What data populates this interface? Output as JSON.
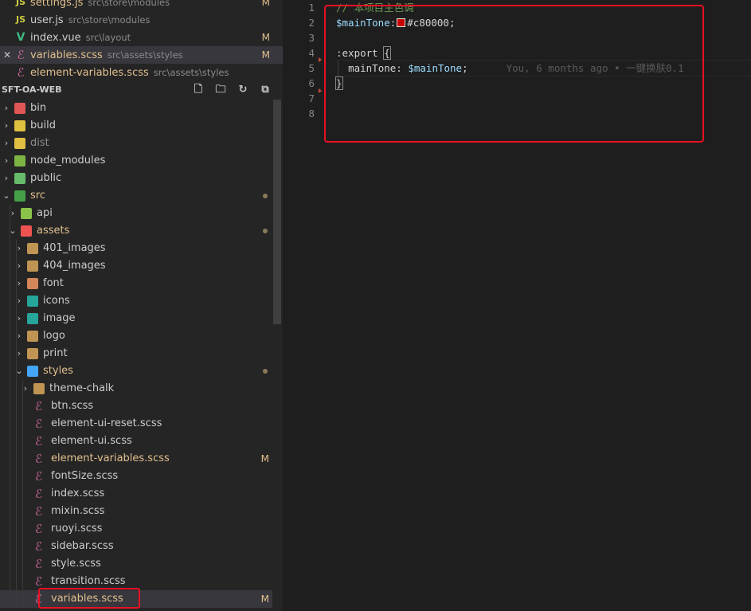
{
  "open_editors": [
    {
      "icon": "js",
      "name": "settings.js",
      "path": "src\\store\\modules",
      "badge": "M",
      "modified": true
    },
    {
      "icon": "js",
      "name": "user.js",
      "path": "src\\store\\modules",
      "badge": "",
      "modified": false
    },
    {
      "icon": "vue",
      "name": "index.vue",
      "path": "src\\layout",
      "badge": "M",
      "modified": false
    },
    {
      "icon": "scss",
      "name": "variables.scss",
      "path": "src\\assets\\styles",
      "badge": "M",
      "modified": true,
      "active": true,
      "close": "✕"
    },
    {
      "icon": "scss",
      "name": "element-variables.scss",
      "path": "src\\assets\\styles",
      "badge": "",
      "modified": true
    }
  ],
  "explorer": {
    "title": "SFT-OA-WEB",
    "tree": [
      {
        "label": "bin",
        "depth": 0,
        "type": "folder",
        "open": false,
        "icon": "bin-folder-icon",
        "color": "#e05555"
      },
      {
        "label": "build",
        "depth": 0,
        "type": "folder",
        "open": false,
        "icon": "build-folder-icon",
        "color": "#e0c040"
      },
      {
        "label": "dist",
        "depth": 0,
        "type": "folder",
        "open": false,
        "icon": "dist-folder-icon",
        "color": "#e0c040",
        "dim": true
      },
      {
        "label": "node_modules",
        "depth": 0,
        "type": "folder",
        "open": false,
        "icon": "node-folder-icon",
        "color": "#7cb342"
      },
      {
        "label": "public",
        "depth": 0,
        "type": "folder",
        "open": false,
        "icon": "public-folder-icon",
        "color": "#66bb6a"
      },
      {
        "label": "src",
        "depth": 0,
        "type": "folder",
        "open": true,
        "icon": "src-folder-icon",
        "color": "#43a047",
        "mod": true,
        "dot": true
      },
      {
        "label": "api",
        "depth": 1,
        "type": "folder",
        "open": false,
        "icon": "api-folder-icon",
        "color": "#8bc34a"
      },
      {
        "label": "assets",
        "depth": 1,
        "type": "folder",
        "open": true,
        "icon": "assets-folder-icon",
        "color": "#ef5350",
        "mod": true,
        "dot": true
      },
      {
        "label": "401_images",
        "depth": 2,
        "type": "folder",
        "open": false,
        "icon": "folder-icon",
        "color": "#c09553"
      },
      {
        "label": "404_images",
        "depth": 2,
        "type": "folder",
        "open": false,
        "icon": "folder-icon",
        "color": "#c09553"
      },
      {
        "label": "font",
        "depth": 2,
        "type": "folder",
        "open": false,
        "icon": "font-folder-icon",
        "color": "#d4875a"
      },
      {
        "label": "icons",
        "depth": 2,
        "type": "folder",
        "open": false,
        "icon": "icons-folder-icon",
        "color": "#26a69a"
      },
      {
        "label": "image",
        "depth": 2,
        "type": "folder",
        "open": false,
        "icon": "image-folder-icon",
        "color": "#26a69a"
      },
      {
        "label": "logo",
        "depth": 2,
        "type": "folder",
        "open": false,
        "icon": "folder-icon",
        "color": "#c09553"
      },
      {
        "label": "print",
        "depth": 2,
        "type": "folder",
        "open": false,
        "icon": "folder-icon",
        "color": "#c09553"
      },
      {
        "label": "styles",
        "depth": 2,
        "type": "folder",
        "open": true,
        "icon": "styles-folder-icon",
        "color": "#42a5f5",
        "mod": true,
        "dot": true
      },
      {
        "label": "theme-chalk",
        "depth": 3,
        "type": "folder",
        "open": false,
        "icon": "folder-icon",
        "color": "#c09553"
      },
      {
        "label": "btn.scss",
        "depth": 3,
        "type": "file",
        "icon": "sass-icon"
      },
      {
        "label": "element-ui-reset.scss",
        "depth": 3,
        "type": "file",
        "icon": "sass-icon"
      },
      {
        "label": "element-ui.scss",
        "depth": 3,
        "type": "file",
        "icon": "sass-icon"
      },
      {
        "label": "element-variables.scss",
        "depth": 3,
        "type": "file",
        "icon": "sass-icon",
        "mod": true,
        "badge": "M"
      },
      {
        "label": "fontSize.scss",
        "depth": 3,
        "type": "file",
        "icon": "sass-icon"
      },
      {
        "label": "index.scss",
        "depth": 3,
        "type": "file",
        "icon": "sass-icon"
      },
      {
        "label": "mixin.scss",
        "depth": 3,
        "type": "file",
        "icon": "sass-icon"
      },
      {
        "label": "ruoyi.scss",
        "depth": 3,
        "type": "file",
        "icon": "sass-icon"
      },
      {
        "label": "sidebar.scss",
        "depth": 3,
        "type": "file",
        "icon": "sass-icon"
      },
      {
        "label": "style.scss",
        "depth": 3,
        "type": "file",
        "icon": "sass-icon"
      },
      {
        "label": "transition.scss",
        "depth": 3,
        "type": "file",
        "icon": "sass-icon"
      },
      {
        "label": "variables.scss",
        "depth": 3,
        "type": "file",
        "icon": "sass-icon",
        "mod": true,
        "badge": "M",
        "selected": true
      }
    ]
  },
  "editor": {
    "line_numbers": [
      "1",
      "2",
      "3",
      "4",
      "5",
      "6",
      "7",
      "8"
    ],
    "lines": {
      "l1_comment": "// 本项目主色调",
      "l2_var": "$mainTone",
      "l2_colon": ":",
      "l2_color": "#c80000",
      "l2_semi": ";",
      "l4_selector": ":export",
      "l4_brace": "{",
      "l5_prop": "mainTone",
      "l5_colon": ": ",
      "l5_var": "$mainTone",
      "l5_semi": ";",
      "l5_blame": "You, 6 months ago • 一键换肤0.1",
      "l6_brace": "}"
    },
    "swatch_color": "#c80000"
  }
}
